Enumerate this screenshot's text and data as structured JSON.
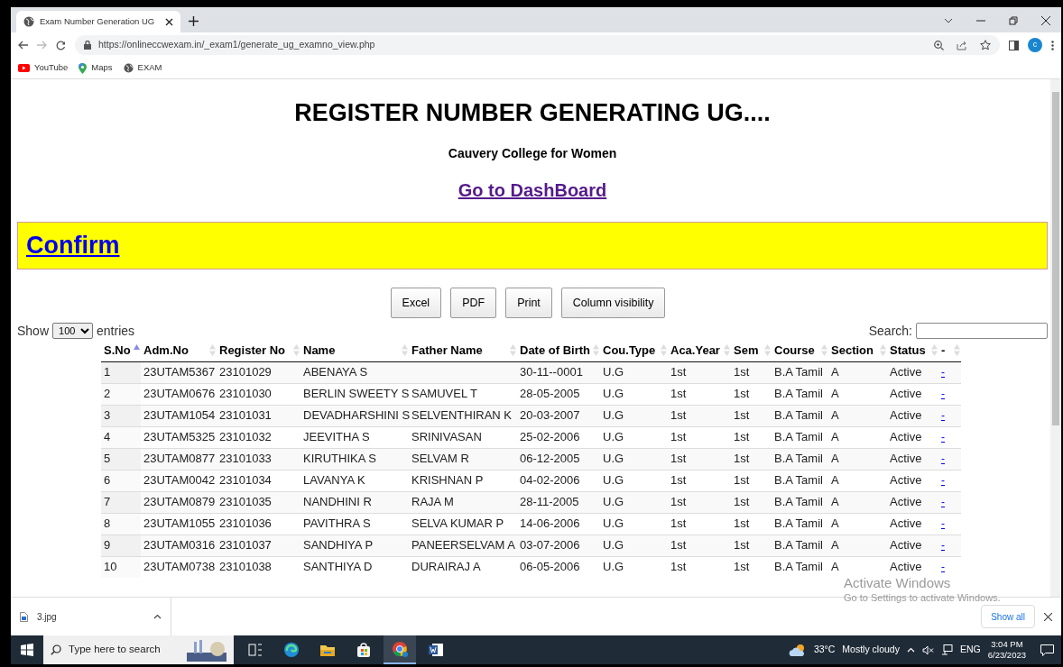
{
  "browser": {
    "tab_title": "Exam Number Generation UG",
    "url": "https://onlineccwexam.in/_exam1/generate_ug_examno_view.php",
    "profile_initial": "c",
    "bookmarks": [
      {
        "kind": "youtube",
        "label": "YouTube"
      },
      {
        "kind": "maps",
        "label": "Maps"
      },
      {
        "kind": "globe",
        "label": "EXAM"
      }
    ]
  },
  "page": {
    "title": "REGISTER NUMBER GENERATING UG....",
    "college": "Cauvery College for Women",
    "dashboard_link": "Go to DashBoard",
    "confirm_link": "Confirm",
    "export_buttons": [
      "Excel",
      "PDF",
      "Print",
      "Column visibility"
    ],
    "length_before": "Show",
    "length_value": "100",
    "length_after": "entries",
    "search_label": "Search:"
  },
  "table": {
    "columns": [
      {
        "label": "S.No",
        "sorted": true
      },
      {
        "label": "Adm.No",
        "sorted": false
      },
      {
        "label": "Register No",
        "sorted": false
      },
      {
        "label": "Name",
        "sorted": false
      },
      {
        "label": "Father Name",
        "sorted": false
      },
      {
        "label": "Date of Birth",
        "sorted": false
      },
      {
        "label": "Cou.Type",
        "sorted": false
      },
      {
        "label": "Aca.Year",
        "sorted": false
      },
      {
        "label": "Sem",
        "sorted": false
      },
      {
        "label": "Course",
        "sorted": false
      },
      {
        "label": "Section",
        "sorted": false
      },
      {
        "label": "Status",
        "sorted": false
      },
      {
        "label": "-",
        "sorted": false
      }
    ],
    "rows": [
      [
        "1",
        "23UTAM5367",
        "23101029",
        "ABENAYA S",
        "",
        "30-11--0001",
        "U.G",
        "1st",
        "1st",
        "B.A Tamil",
        "A",
        "Active",
        "-"
      ],
      [
        "2",
        "23UTAM0676",
        "23101030",
        "BERLIN SWEETY S",
        "SAMUVEL T",
        "28-05-2005",
        "U.G",
        "1st",
        "1st",
        "B.A Tamil",
        "A",
        "Active",
        "-"
      ],
      [
        "3",
        "23UTAM1054",
        "23101031",
        "DEVADHARSHINI S",
        "SELVENTHIRAN K",
        "20-03-2007",
        "U.G",
        "1st",
        "1st",
        "B.A Tamil",
        "A",
        "Active",
        "-"
      ],
      [
        "4",
        "23UTAM5325",
        "23101032",
        "JEEVITHA S",
        "SRINIVASAN",
        "25-02-2006",
        "U.G",
        "1st",
        "1st",
        "B.A Tamil",
        "A",
        "Active",
        "-"
      ],
      [
        "5",
        "23UTAM0877",
        "23101033",
        "KIRUTHIKA S",
        "SELVAM R",
        "06-12-2005",
        "U.G",
        "1st",
        "1st",
        "B.A Tamil",
        "A",
        "Active",
        "-"
      ],
      [
        "6",
        "23UTAM0042",
        "23101034",
        "LAVANYA K",
        "KRISHNAN P",
        "04-02-2006",
        "U.G",
        "1st",
        "1st",
        "B.A Tamil",
        "A",
        "Active",
        "-"
      ],
      [
        "7",
        "23UTAM0879",
        "23101035",
        "NANDHINI R",
        "RAJA M",
        "28-11-2005",
        "U.G",
        "1st",
        "1st",
        "B.A Tamil",
        "A",
        "Active",
        "-"
      ],
      [
        "8",
        "23UTAM1055",
        "23101036",
        "PAVITHRA S",
        "SELVA KUMAR P",
        "14-06-2006",
        "U.G",
        "1st",
        "1st",
        "B.A Tamil",
        "A",
        "Active",
        "-"
      ],
      [
        "9",
        "23UTAM0316",
        "23101037",
        "SANDHIYA P",
        "PANEERSELVAM A",
        "03-07-2006",
        "U.G",
        "1st",
        "1st",
        "B.A Tamil",
        "A",
        "Active",
        "-"
      ],
      [
        "10",
        "23UTAM0738",
        "23101038",
        "SANTHIYA D",
        "DURAIRAJ A",
        "06-05-2006",
        "U.G",
        "1st",
        "1st",
        "B.A Tamil",
        "A",
        "Active",
        "-"
      ]
    ]
  },
  "activation_notice": {
    "title": "Activate Windows",
    "hint": "Go to Settings to activate Windows."
  },
  "downloads": {
    "file": "3.jpg",
    "show_all": "Show all"
  },
  "taskbar": {
    "search_placeholder": "Type here to search",
    "apps": [
      {
        "kind": "taskview",
        "active": false
      },
      {
        "kind": "edge",
        "active": false
      },
      {
        "kind": "explorer",
        "active": false
      },
      {
        "kind": "store",
        "active": false
      },
      {
        "kind": "chrome",
        "active": true
      },
      {
        "kind": "word",
        "active": false
      }
    ],
    "temperature": "33°C",
    "weather": "Mostly cloudy",
    "language": "ENG",
    "time": "3:04 PM",
    "date": "6/23/2023"
  }
}
